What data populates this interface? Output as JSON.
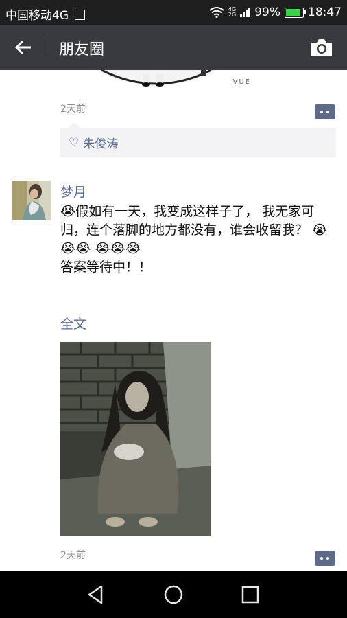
{
  "status_bar": {
    "carrier": "中国移动4G",
    "network_top": "4G",
    "network_bottom": "2G",
    "battery": "99%",
    "time": "18:47"
  },
  "header": {
    "title": "朋友圈"
  },
  "previous_post": {
    "image_watermark": "VUE",
    "time": "2天前",
    "liked_by": "朱俊涛"
  },
  "post": {
    "author": "梦月",
    "text": "😭假如有一天，我变成这样子了， 我无家可归，连个落脚的地方都没有，谁会收留我？ 😭😭😭 😭😭😭\n答案等待中！！",
    "full_text_link": "全文",
    "time": "2天前"
  },
  "colors": {
    "link_blue": "#576b95",
    "header_bg": "#393a3f",
    "status_bg": "#1f1f1f"
  }
}
